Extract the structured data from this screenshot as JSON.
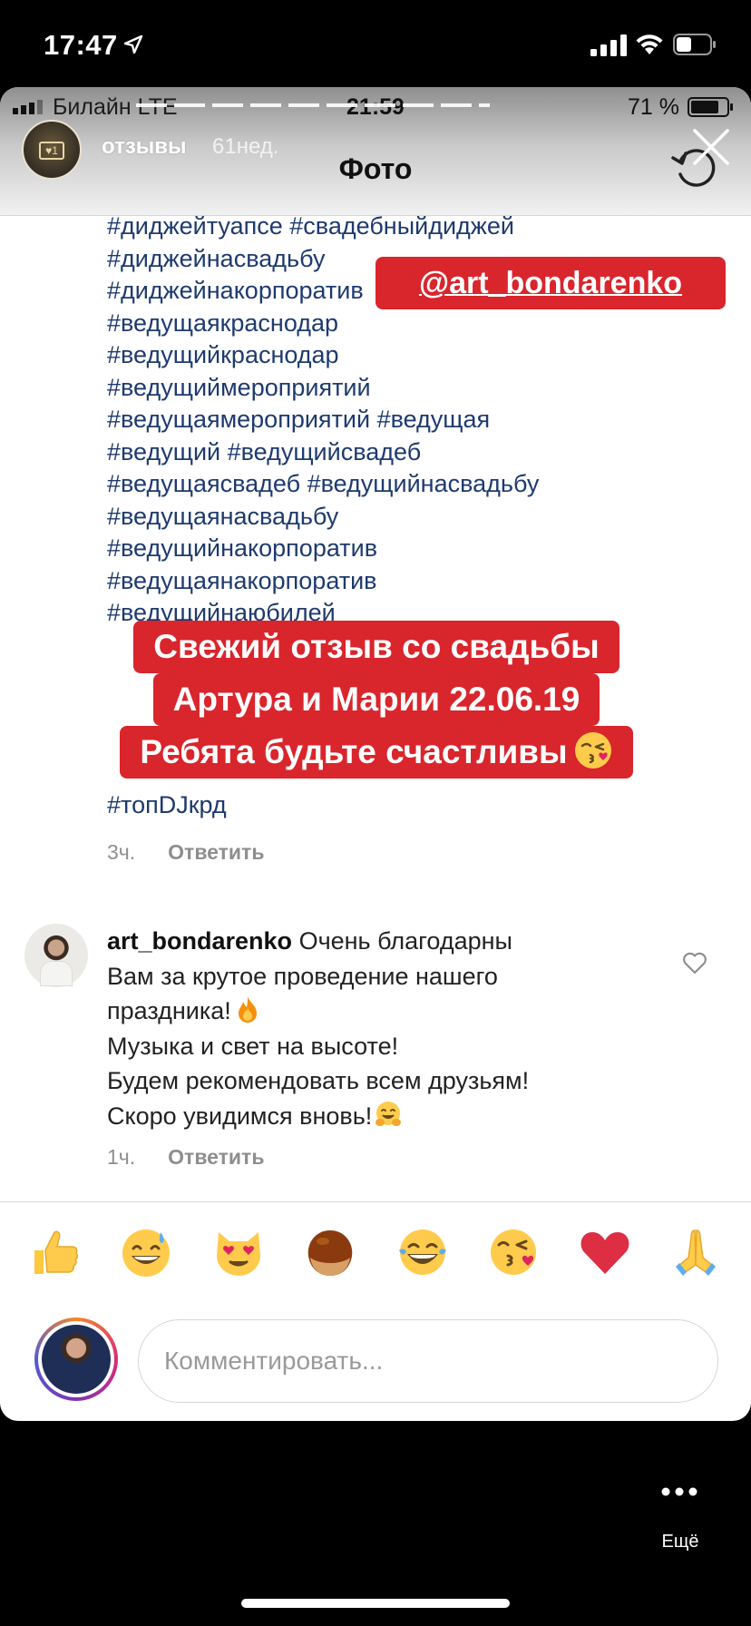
{
  "device_status": {
    "time": "17:47",
    "icons": [
      "location-icon",
      "signal-icon",
      "wifi-icon",
      "battery-icon"
    ]
  },
  "inner_status": {
    "carrier": "Билайн  LTE",
    "time": "21:59",
    "battery": "71 %"
  },
  "inner_header": {
    "title": "Фото"
  },
  "story": {
    "username": "отзывы",
    "time_ago": "61нед."
  },
  "caption": {
    "lines": [
      "#диджейтуапсе #свадебныйдиджей",
      "#диджейнасвадьбу",
      "#диджейнакорпоратив",
      "#ведущаякраснодар",
      "#ведущийкраснодар",
      "#ведущиймероприятий",
      "#ведущаямероприятий #ведущая",
      "#ведущий #ведущийсвадеб",
      "#ведущаясвадеб #ведущийнасвадьбу",
      "#ведущаянасвадьбу",
      "#ведущийнакорпоратив",
      "#ведущаянакорпоратив",
      "#ведущийнаюбилей"
    ],
    "last_tag": "#топDJкрд",
    "time": "3ч.",
    "reply": "Ответить"
  },
  "stickers": {
    "mention": "@art_bondarenko",
    "text_lines": [
      "Свежий отзыв со свадьбы",
      "Артура и Марии 22.06.19",
      "Ребята будьте счастливы"
    ]
  },
  "comment": {
    "username": "art_bondarenko",
    "lines": [
      "Очень благодарны",
      "Вам за крутое проведение нашего",
      "праздника!",
      "Музыка и свет на высоте!",
      "Будем рекомендовать всем друзьям!",
      "Скоро увидимся вновь!"
    ],
    "time": "1ч.",
    "reply": "Ответить"
  },
  "emoji_bar": [
    "thumbs-up",
    "grinning-sweat",
    "heart-eyes-cat",
    "chestnut",
    "tears-of-joy",
    "face-blowing-kiss",
    "red-heart",
    "folded-hands"
  ],
  "input": {
    "placeholder": "Комментировать..."
  },
  "story_footer": {
    "more_label": "Ещё"
  },
  "colors": {
    "sticker_red": "#d9252c",
    "hashtag_blue": "#1e3a6e",
    "meta_grey": "#8e8e8e"
  }
}
